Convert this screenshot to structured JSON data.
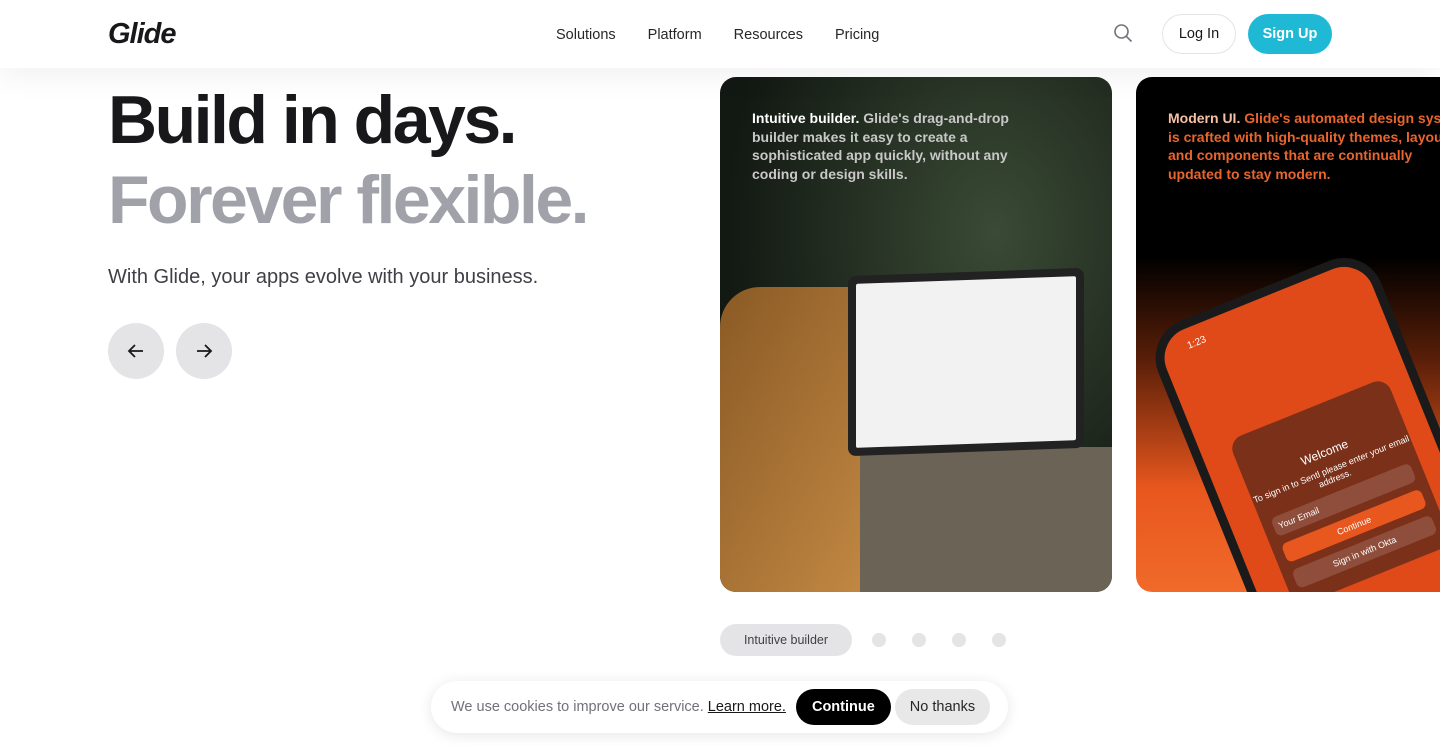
{
  "nav": {
    "logo": "Glide",
    "items": [
      "Solutions",
      "Platform",
      "Resources",
      "Pricing"
    ],
    "login": "Log In",
    "signup": "Sign Up"
  },
  "hero": {
    "title1": "Build in days.",
    "title2": "Forever flexible.",
    "subtitle": "With Glide, your apps evolve with your business."
  },
  "cards": [
    {
      "lead": "Intuitive builder.",
      "text": " Glide's drag-and-drop builder makes it easy to create a sophisticated app quickly, without any coding or design skills."
    },
    {
      "lead": "Modern UI.",
      "text": " Glide's automated design system is crafted with high-quality themes, layouts, and components that are continually updated to stay modern.",
      "phone": {
        "time": "1:23",
        "welcome": "Welcome",
        "prompt": "To sign in to Sentl please enter your email address.",
        "email_placeholder": "Your Email",
        "continue": "Continue",
        "okta": "Sign in with Okta"
      }
    }
  ],
  "carousel": {
    "active_label": "Intuitive builder",
    "dots": 4
  },
  "cookie": {
    "text": "We use cookies to improve our service.",
    "learn": "Learn more.",
    "continue": "Continue",
    "no": "No thanks"
  },
  "colors": {
    "accent": "#1fb9d6",
    "orange": "#e8571e"
  }
}
